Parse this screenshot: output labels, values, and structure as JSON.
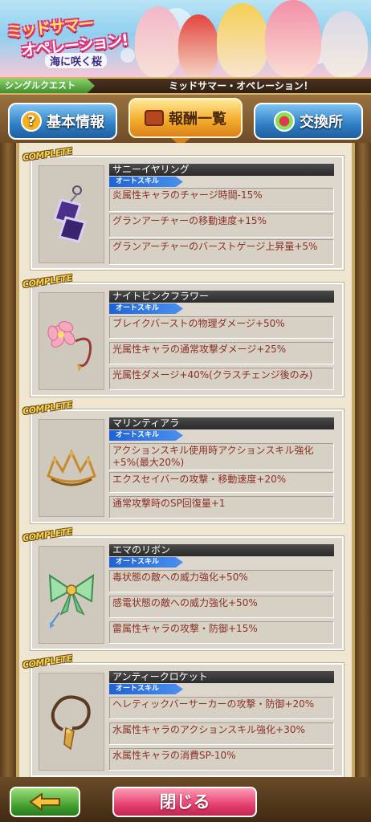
{
  "banner": {
    "logo_line1": "ミッドサマー",
    "logo_line2": "オペレーション!",
    "logo_sub": "海に咲く桜"
  },
  "quest_bar": {
    "label": "シングルクエスト",
    "title": "ミッドサマー・オペレーション！"
  },
  "tabs": [
    {
      "label": "基本情報",
      "icon": "question-icon"
    },
    {
      "label": "報酬一覧",
      "icon": "treasure-chest-icon",
      "active": true
    },
    {
      "label": "交換所",
      "icon": "exchange-icon"
    }
  ],
  "complete_label": "COMPLETE",
  "auto_skill_label": "オートスキル",
  "rewards": [
    {
      "name": "サニーイヤリング",
      "icon": "earring-icon",
      "skills": [
        "炎属性キャラのチャージ時間-15%",
        "グランアーチャーの移動速度+15%",
        "グランアーチャーのバーストゲージ上昇量+5%"
      ]
    },
    {
      "name": "ナイトピンクフラワー",
      "icon": "pink-flower-icon",
      "skills": [
        "ブレイクバーストの物理ダメージ+50%",
        "光属性キャラの通常攻撃ダメージ+25%",
        "光属性ダメージ+40%(クラスチェンジ後のみ)"
      ]
    },
    {
      "name": "マリンティアラ",
      "icon": "tiara-icon",
      "skills": [
        "アクションスキル使用時アクションスキル強化+5%(最大20%)",
        "エクスセイバーの攻撃・移動速度+20%",
        "通常攻撃時のSP回復量+1"
      ]
    },
    {
      "name": "エマのリボン",
      "icon": "ribbon-icon",
      "skills": [
        "毒状態の敵への威力強化+50%",
        "感電状態の敵への威力強化+50%",
        "雷属性キャラの攻撃・防御+15%"
      ]
    },
    {
      "name": "アンティークロケット",
      "icon": "locket-icon",
      "skills": [
        "ヘレティックバーサーカーの攻撃・防御+20%",
        "水属性キャラのアクションスキル強化+30%",
        "水属性キャラの消費SP-10%"
      ]
    }
  ],
  "footer": {
    "back_icon": "left-arrow-icon",
    "close_label": "閉じる"
  }
}
